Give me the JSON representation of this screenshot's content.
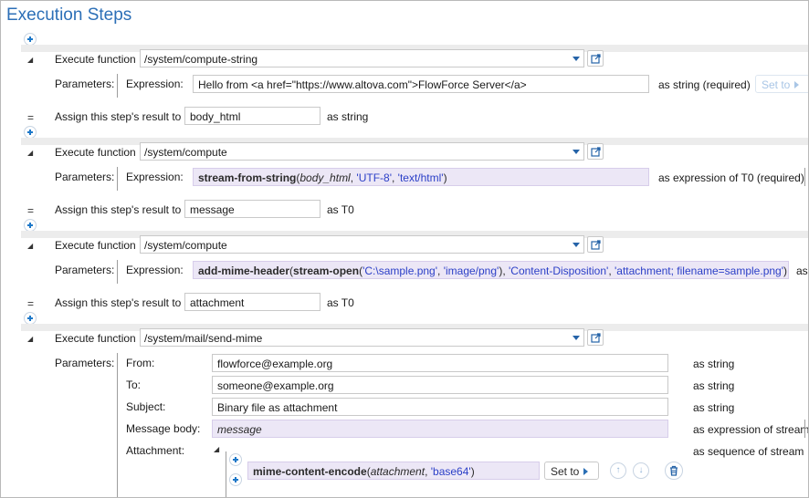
{
  "title": "Execution Steps",
  "labels": {
    "execute_function": "Execute function",
    "parameters": "Parameters:",
    "expression": "Expression:",
    "assign": "Assign this step's result to",
    "set_to": "Set to",
    "from": "From:",
    "to": "To:",
    "subject": "Subject:",
    "message_body": "Message body:",
    "attachment": "Attachment:"
  },
  "steps": [
    {
      "function": "/system/compute-string",
      "expression": "Hello from <a href=\"https://www.altova.com\">FlowForce Server</a>",
      "type": "as string (required)",
      "result_var": "body_html",
      "result_type": "as string"
    },
    {
      "function": "/system/compute",
      "expression_parts": {
        "fn": "stream-from-string",
        "open": "(",
        "arg": "body_html",
        "sep1": ", ",
        "s1": "'UTF-8'",
        "sep2": ", ",
        "s2": "'text/html'",
        "close": ")"
      },
      "type": "as expression of T0 (required)",
      "result_var": "message",
      "result_type": "as T0"
    },
    {
      "function": "/system/compute",
      "expression_parts": {
        "fn1": "add-mime-header",
        "open1": "(",
        "fn2": "stream-open",
        "open2": "(",
        "s1": "'C:\\sample.png'",
        "sep1": ", ",
        "s2": "'image/png'",
        "close2": "), ",
        "s3": "'Content-Disposition'",
        "sep2": ", ",
        "s4": "'attachment; filename=sample.png'",
        "close1": ")"
      },
      "type_partial": "as",
      "result_var": "attachment",
      "result_type": "as T0"
    },
    {
      "function": "/system/mail/send-mime",
      "from": "flowforce@example.org",
      "from_type": "as string",
      "to": "someone@example.org",
      "to_type": "as string",
      "subject": "Binary file as attachment",
      "subject_type": "as string",
      "message_body": "message",
      "message_body_type": "as expression of stream",
      "attachment_type": "as sequence of stream",
      "attachment_expr": {
        "fn": "mime-content-encode",
        "open": "(",
        "arg": "attachment",
        "sep": ", ",
        "s1": "'base64'",
        "close": ")"
      }
    }
  ],
  "icons": {
    "add": "add-step-icon",
    "collapse": "collapse-caret-icon",
    "external": "open-external-icon",
    "dropdown": "chevron-down-icon",
    "move_up": "arrow-up-icon",
    "move_down": "arrow-down-icon",
    "delete": "trash-icon"
  },
  "colors": {
    "title": "#2c6fb7",
    "accent": "#1d78c9",
    "expression_bg": "#ece7f6",
    "string_literal": "#2b3fc7"
  },
  "symbols": {
    "collapse": "◢",
    "eq": "=",
    "up": "↑",
    "down": "↓"
  }
}
